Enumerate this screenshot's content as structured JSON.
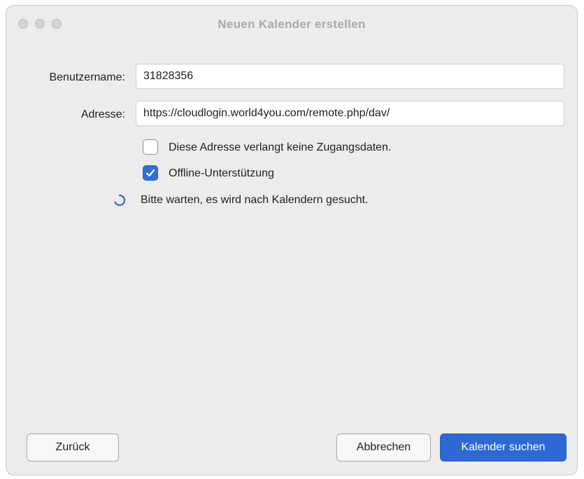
{
  "window": {
    "title": "Neuen Kalender erstellen"
  },
  "form": {
    "username_label": "Benutzername:",
    "username_value": "31828356",
    "address_label": "Adresse:",
    "address_value": "https://cloudlogin.world4you.com/remote.php/dav/"
  },
  "options": {
    "no_credentials": {
      "label": "Diese Adresse verlangt keine Zugangsdaten.",
      "checked": false
    },
    "offline_support": {
      "label": "Offline-Unterstützung",
      "checked": true
    }
  },
  "status": {
    "text": "Bitte warten, es wird nach Kalendern gesucht."
  },
  "buttons": {
    "back": "Zurück",
    "cancel": "Abbrechen",
    "search": "Kalender suchen"
  },
  "colors": {
    "accent": "#2e69d3",
    "window_bg": "#ececec"
  }
}
